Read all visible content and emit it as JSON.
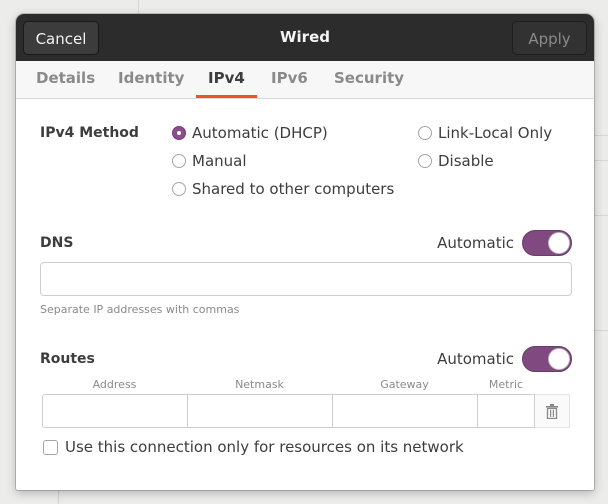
{
  "header": {
    "cancel_label": "Cancel",
    "title": "Wired",
    "apply_label": "Apply"
  },
  "tabs": [
    {
      "label": "Details"
    },
    {
      "label": "Identity"
    },
    {
      "label": "IPv4",
      "active": true
    },
    {
      "label": "IPv6"
    },
    {
      "label": "Security"
    }
  ],
  "ipv4_method": {
    "label": "IPv4 Method",
    "options": [
      {
        "label": "Automatic (DHCP)",
        "selected": true
      },
      {
        "label": "Manual",
        "selected": false
      },
      {
        "label": "Shared to other computers",
        "selected": false
      },
      {
        "label": "Link-Local Only",
        "selected": false
      },
      {
        "label": "Disable",
        "selected": false
      }
    ]
  },
  "dns": {
    "label": "DNS",
    "auto_label": "Automatic",
    "auto_on": true,
    "value": "",
    "hint": "Separate IP addresses with commas"
  },
  "routes": {
    "label": "Routes",
    "auto_label": "Automatic",
    "auto_on": true,
    "columns": [
      "Address",
      "Netmask",
      "Gateway",
      "Metric"
    ],
    "row": [
      "",
      "",
      "",
      ""
    ]
  },
  "only_resources": {
    "label": "Use this connection only for resources on its network",
    "checked": false
  },
  "colors": {
    "accent": "#e95420",
    "toggle": "#804a80",
    "header": "#2c2c2c"
  },
  "icons": {
    "trash": "trash-icon"
  }
}
